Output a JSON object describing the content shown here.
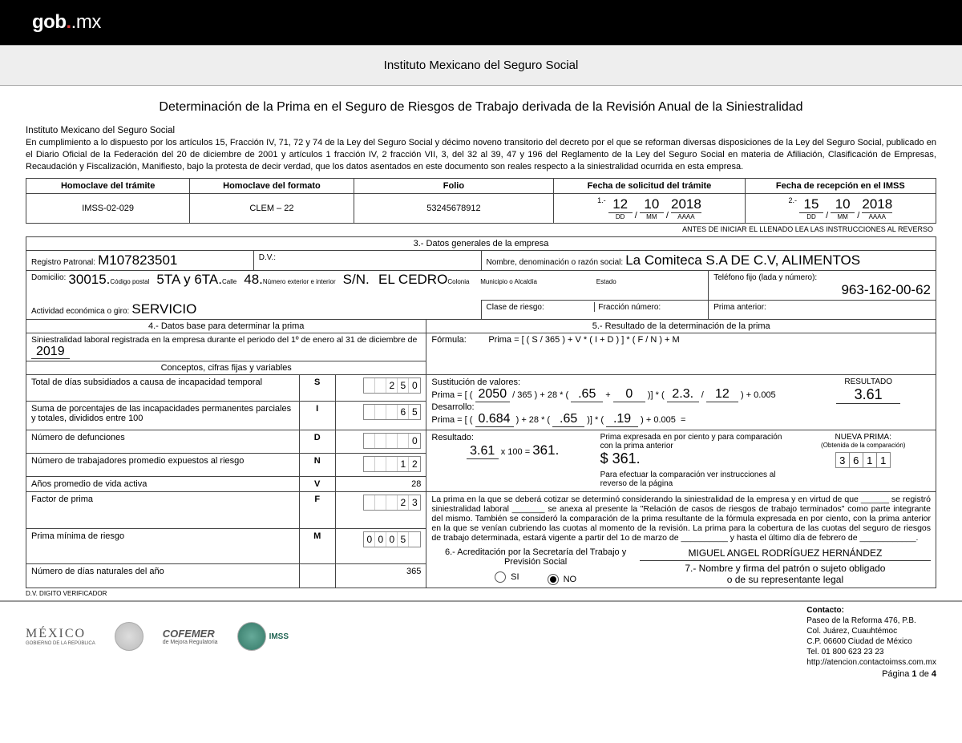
{
  "header": {
    "logo_a": "gob",
    "logo_b": ".mx",
    "institute": "Instituto Mexicano del Seguro Social"
  },
  "title": "Determinación de la Prima en el Seguro de Riesgos de Trabajo derivada de la Revisión Anual de la Siniestralidad",
  "legal_head": "Instituto Mexicano del Seguro Social",
  "legal_body": "En cumplimiento a lo dispuesto por los artículos 15, Fracción IV, 71, 72 y 74 de la Ley del Seguro Social y décimo noveno transitorio del decreto por el que se reforman diversas disposiciones de la Ley del Seguro Social, publicado en el Diario Oficial de la Federación del 20 de diciembre de 2001 y artículos 1 fracción IV, 2 fracción VII, 3, del 32 al 39, 47 y 196 del Reglamento de la Ley del Seguro Social en materia de Afiliación, Clasificación de Empresas, Recaudación y Fiscalización, Manifiesto, bajo la protesta de decir verdad, que los datos asentados en este documento son reales respecto a la siniestralidad ocurrida en esta empresa.",
  "meta": {
    "h1": "Homoclave del trámite",
    "h2": "Homoclave del formato",
    "h3": "Folio",
    "h4": "Fecha de solicitud del trámite",
    "h5": "Fecha de recepción en el IMSS",
    "v1": "IMSS-02-029",
    "v2": "CLEM – 22",
    "folio": "53245678912",
    "n1": "1.-",
    "n2": "2.-",
    "dd": "DD",
    "mm": "MM",
    "aaaa": "AAAA",
    "d1_dd": "12",
    "d1_mm": "10",
    "d1_yy": "2018",
    "d2_dd": "15",
    "d2_mm": "10",
    "d2_yy": "2018",
    "reverse_note": "ANTES DE INICIAR EL LLENADO LEA LAS INSTRUCCIONES AL REVERSO"
  },
  "s3": {
    "head": "3.- Datos generales de la empresa",
    "reg_lab": "Registro Patronal:",
    "reg_val": "M107823501",
    "dv_lab": "D.V.:",
    "name_lab": "Nombre, denominación o razón social:",
    "name_val": "La Comiteca S.A DE C.V, ALIMENTOS",
    "dom_lab": "Domicilio:",
    "cp": "30015.",
    "cp_l": "Código postal",
    "calle": "5TA y 6TA.",
    "calle_l": "Calle",
    "num": "48.",
    "num_l": "Número exterior e interior",
    "sn": "S/N.",
    "col": "EL CEDRO",
    "col_l": "Colonia",
    "mun_l": "Municipio o Alcaldía",
    "edo_l": "Estado",
    "tel_lab": "Teléfono fijo (lada y número):",
    "tel_val": "963-162-00-62",
    "act_lab": "Actividad económica o giro:",
    "act_val": "SERVICIO",
    "clase_lab": "Clase de riesgo:",
    "frac_lab": "Fracción número:",
    "prima_ant_lab": "Prima anterior:"
  },
  "s4": {
    "head": "4.- Datos base para determinar la prima",
    "period_text": "Siniestralidad laboral registrada en la empresa durante el periodo del 1º de enero al 31 de diciembre de",
    "period_year": "2019",
    "concepts_head": "Conceptos, cifras fijas y variables",
    "rows": [
      {
        "label": "Total de días subsidiados a causa de incapacidad temporal",
        "code": "S",
        "digits": [
          "",
          "",
          "2",
          "5",
          "0"
        ]
      },
      {
        "label": "Suma de porcentajes de las incapacidades permanentes parciales y totales, divididos entre 100",
        "code": "I",
        "digits": [
          "",
          "",
          "",
          "6",
          "5"
        ]
      },
      {
        "label": "Número de defunciones",
        "code": "D",
        "digits": [
          "",
          "",
          "",
          "",
          "0"
        ]
      },
      {
        "label": "Número de trabajadores promedio expuestos al riesgo",
        "code": "N",
        "digits": [
          "",
          "",
          "",
          "1",
          "2"
        ]
      },
      {
        "label": "Años promedio de vida activa",
        "code": "V",
        "plain": "28"
      },
      {
        "label": "Factor de prima",
        "code": "F",
        "digits": [
          "",
          "",
          "",
          "2",
          "3"
        ]
      },
      {
        "label": "Prima mínima de riesgo",
        "code": "M",
        "digits": [
          "0",
          "0",
          "0",
          "5",
          ""
        ]
      },
      {
        "label": "Número de días naturales del año",
        "code": "",
        "plain": "365"
      }
    ],
    "dv_note": "D.V. DIGITO VERIFICADOR"
  },
  "s5": {
    "head": "5.- Resultado de la determinación de la prima",
    "f_lab": "Fórmula:",
    "f_eq": "Prima = [ ( S / 365  ) + V * ( I + D ) ] * ( F / N  ) + M",
    "sub_lab": "Sustitución de valores:",
    "sub_pfx": "Prima = [ (",
    "sub_v1": "2050",
    "sub_m1": "/ 365 ) + 28 * (",
    "sub_v2": ".65",
    "sub_p": "+",
    "sub_v3": "0",
    "sub_m2": ")] * (",
    "sub_v4": "2.3.",
    "sub_sl": "/",
    "sub_v5": "12",
    "sub_pM": ") + 0.005",
    "dev_lab": "Desarrollo:",
    "dev_pfx": "Prima = [ (",
    "dev_v1": "0.684",
    "dev_m1": ") + 28 * (",
    "dev_v2": ".65",
    "dev_m2": ")] * (",
    "dev_v3": ".19",
    "dev_pM": ") + 0.005",
    "dev_eq": "=",
    "res_title": "RESULTADO",
    "res_val": "3.61",
    "r_lab": "Resultado:",
    "r_v1": "3.61",
    "r_m": " x 100 = ",
    "r_v2": "361.",
    "pct_text": "Prima expresada en por ciento y para comparación con la prima anterior",
    "pct_val": "$ 361.",
    "compare_text": "Para efectuar la comparación ver instrucciones al reverso de la página",
    "np_title": "NUEVA PRIMA:",
    "np_sub": "(Obtenida de la comparación)",
    "np_digits": [
      "3",
      "6",
      "1",
      "1"
    ],
    "para": "La prima en la que se deberá cotizar se determinó considerando la siniestralidad de la empresa y en virtud de que ______ se registró siniestralidad laboral _______ se anexa al presente la \"Relación de casos de riesgos de trabajo terminados\" como parte integrante del mismo. También se consideró la comparación de la prima resultante de la fórmula expresada en por ciento, con la prima anterior en la que se venían cubriendo las cuotas al momento de la revisión. La prima para la cobertura de las cuotas del seguro de riesgos de trabajo determinada, estará vigente a partir del 1o de marzo de __________ y hasta el último día de febrero de ____________."
  },
  "s6": {
    "head": "6.- Acreditación por la Secretaría del Trabajo y Previsión Social",
    "si": "SI",
    "no": "NO"
  },
  "s7": {
    "name": "MIGUEL ANGEL RODRÍGUEZ HERNÁNDEZ",
    "line1": "7.- Nombre y firma del patrón o sujeto obligado",
    "line2": "o de su representante legal"
  },
  "footer": {
    "mexico": "MÉXICO",
    "mexico_sub": "GOBIERNO DE LA REPÚBLICA",
    "cofemer": "COFEMER",
    "cofemer_sub": "de Mejora Regulatoria",
    "imss": "IMSS",
    "c_head": "Contacto:",
    "c1": "Paseo de la Reforma 476, P.B.",
    "c2": "Col. Juárez, Cuauhtémoc",
    "c3": "C.P. 06600 Ciudad de México",
    "c4": "Tel. 01 800 623 23 23",
    "c5": "http://atencion.contactoimss.com.mx",
    "page_a": "Página ",
    "page_n": "1",
    "page_b": " de ",
    "page_t": "4"
  }
}
